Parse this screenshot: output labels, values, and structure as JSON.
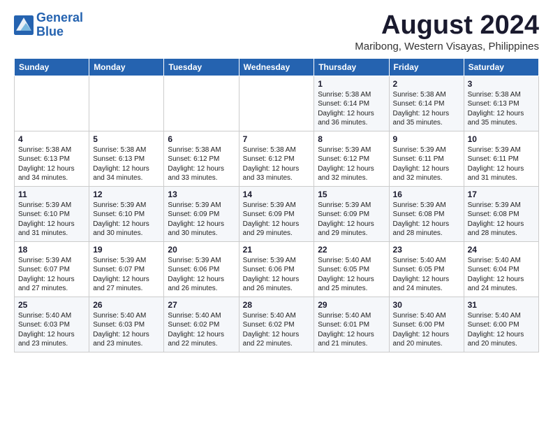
{
  "logo": {
    "line1": "General",
    "line2": "Blue"
  },
  "title": "August 2024",
  "subtitle": "Maribong, Western Visayas, Philippines",
  "weekdays": [
    "Sunday",
    "Monday",
    "Tuesday",
    "Wednesday",
    "Thursday",
    "Friday",
    "Saturday"
  ],
  "weeks": [
    [
      {
        "day": "",
        "info": ""
      },
      {
        "day": "",
        "info": ""
      },
      {
        "day": "",
        "info": ""
      },
      {
        "day": "",
        "info": ""
      },
      {
        "day": "1",
        "info": "Sunrise: 5:38 AM\nSunset: 6:14 PM\nDaylight: 12 hours\nand 36 minutes."
      },
      {
        "day": "2",
        "info": "Sunrise: 5:38 AM\nSunset: 6:14 PM\nDaylight: 12 hours\nand 35 minutes."
      },
      {
        "day": "3",
        "info": "Sunrise: 5:38 AM\nSunset: 6:13 PM\nDaylight: 12 hours\nand 35 minutes."
      }
    ],
    [
      {
        "day": "4",
        "info": "Sunrise: 5:38 AM\nSunset: 6:13 PM\nDaylight: 12 hours\nand 34 minutes."
      },
      {
        "day": "5",
        "info": "Sunrise: 5:38 AM\nSunset: 6:13 PM\nDaylight: 12 hours\nand 34 minutes."
      },
      {
        "day": "6",
        "info": "Sunrise: 5:38 AM\nSunset: 6:12 PM\nDaylight: 12 hours\nand 33 minutes."
      },
      {
        "day": "7",
        "info": "Sunrise: 5:38 AM\nSunset: 6:12 PM\nDaylight: 12 hours\nand 33 minutes."
      },
      {
        "day": "8",
        "info": "Sunrise: 5:39 AM\nSunset: 6:12 PM\nDaylight: 12 hours\nand 32 minutes."
      },
      {
        "day": "9",
        "info": "Sunrise: 5:39 AM\nSunset: 6:11 PM\nDaylight: 12 hours\nand 32 minutes."
      },
      {
        "day": "10",
        "info": "Sunrise: 5:39 AM\nSunset: 6:11 PM\nDaylight: 12 hours\nand 31 minutes."
      }
    ],
    [
      {
        "day": "11",
        "info": "Sunrise: 5:39 AM\nSunset: 6:10 PM\nDaylight: 12 hours\nand 31 minutes."
      },
      {
        "day": "12",
        "info": "Sunrise: 5:39 AM\nSunset: 6:10 PM\nDaylight: 12 hours\nand 30 minutes."
      },
      {
        "day": "13",
        "info": "Sunrise: 5:39 AM\nSunset: 6:09 PM\nDaylight: 12 hours\nand 30 minutes."
      },
      {
        "day": "14",
        "info": "Sunrise: 5:39 AM\nSunset: 6:09 PM\nDaylight: 12 hours\nand 29 minutes."
      },
      {
        "day": "15",
        "info": "Sunrise: 5:39 AM\nSunset: 6:09 PM\nDaylight: 12 hours\nand 29 minutes."
      },
      {
        "day": "16",
        "info": "Sunrise: 5:39 AM\nSunset: 6:08 PM\nDaylight: 12 hours\nand 28 minutes."
      },
      {
        "day": "17",
        "info": "Sunrise: 5:39 AM\nSunset: 6:08 PM\nDaylight: 12 hours\nand 28 minutes."
      }
    ],
    [
      {
        "day": "18",
        "info": "Sunrise: 5:39 AM\nSunset: 6:07 PM\nDaylight: 12 hours\nand 27 minutes."
      },
      {
        "day": "19",
        "info": "Sunrise: 5:39 AM\nSunset: 6:07 PM\nDaylight: 12 hours\nand 27 minutes."
      },
      {
        "day": "20",
        "info": "Sunrise: 5:39 AM\nSunset: 6:06 PM\nDaylight: 12 hours\nand 26 minutes."
      },
      {
        "day": "21",
        "info": "Sunrise: 5:39 AM\nSunset: 6:06 PM\nDaylight: 12 hours\nand 26 minutes."
      },
      {
        "day": "22",
        "info": "Sunrise: 5:40 AM\nSunset: 6:05 PM\nDaylight: 12 hours\nand 25 minutes."
      },
      {
        "day": "23",
        "info": "Sunrise: 5:40 AM\nSunset: 6:05 PM\nDaylight: 12 hours\nand 24 minutes."
      },
      {
        "day": "24",
        "info": "Sunrise: 5:40 AM\nSunset: 6:04 PM\nDaylight: 12 hours\nand 24 minutes."
      }
    ],
    [
      {
        "day": "25",
        "info": "Sunrise: 5:40 AM\nSunset: 6:03 PM\nDaylight: 12 hours\nand 23 minutes."
      },
      {
        "day": "26",
        "info": "Sunrise: 5:40 AM\nSunset: 6:03 PM\nDaylight: 12 hours\nand 23 minutes."
      },
      {
        "day": "27",
        "info": "Sunrise: 5:40 AM\nSunset: 6:02 PM\nDaylight: 12 hours\nand 22 minutes."
      },
      {
        "day": "28",
        "info": "Sunrise: 5:40 AM\nSunset: 6:02 PM\nDaylight: 12 hours\nand 22 minutes."
      },
      {
        "day": "29",
        "info": "Sunrise: 5:40 AM\nSunset: 6:01 PM\nDaylight: 12 hours\nand 21 minutes."
      },
      {
        "day": "30",
        "info": "Sunrise: 5:40 AM\nSunset: 6:00 PM\nDaylight: 12 hours\nand 20 minutes."
      },
      {
        "day": "31",
        "info": "Sunrise: 5:40 AM\nSunset: 6:00 PM\nDaylight: 12 hours\nand 20 minutes."
      }
    ]
  ]
}
